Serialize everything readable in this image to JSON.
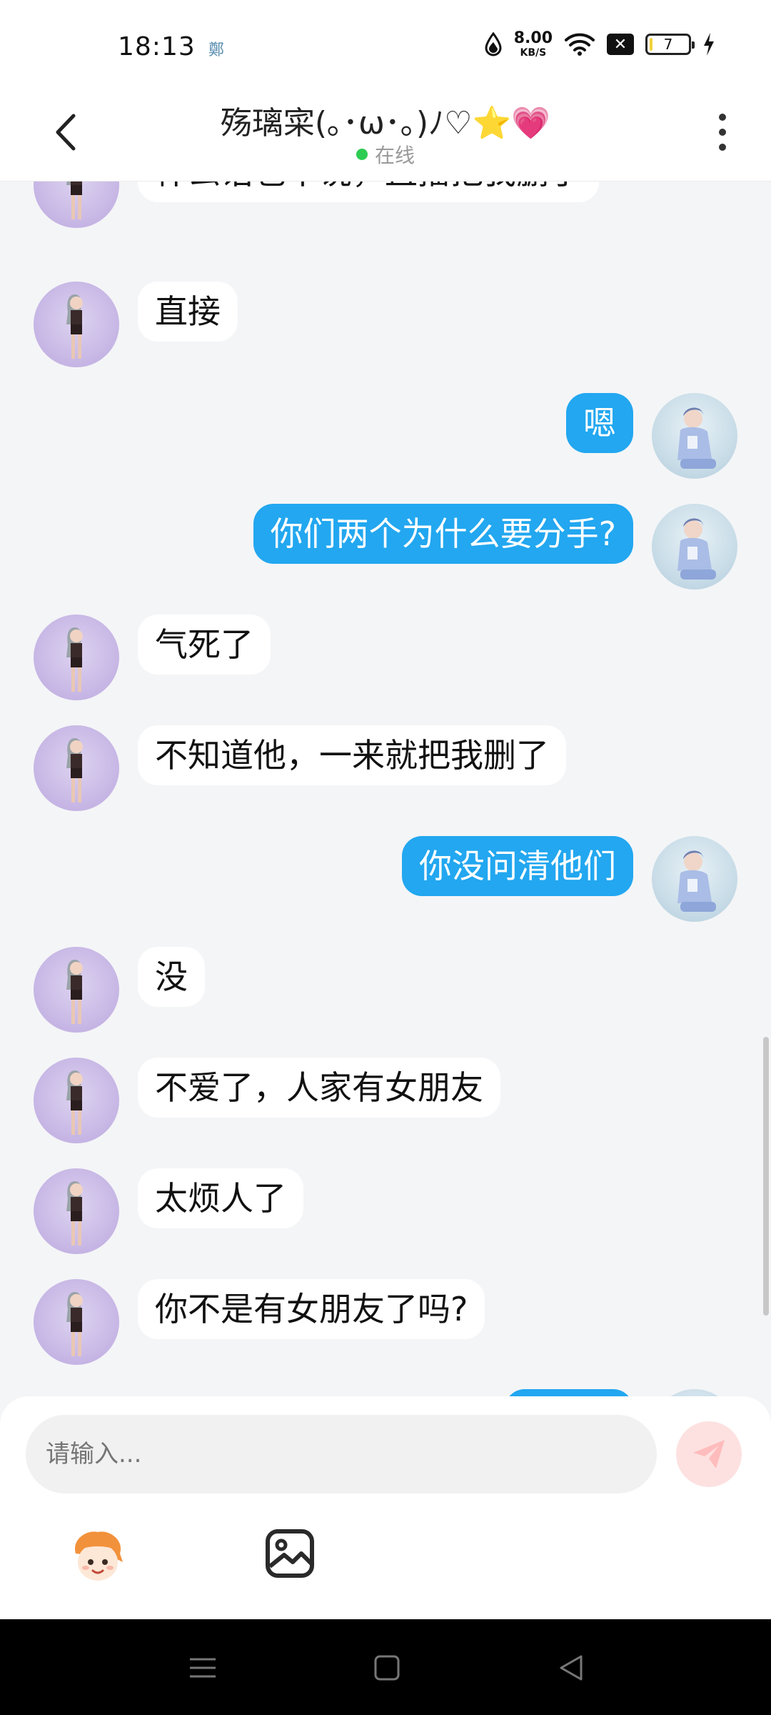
{
  "status_bar": {
    "time": "18:13",
    "app_icon": "鄭",
    "net_speed_value": "8.00",
    "net_speed_unit": "KB/S",
    "battery_level": "7"
  },
  "header": {
    "title": "殇璃寀(｡･ω･｡)ﾉ♡⭐💗",
    "status": "在线"
  },
  "messages": [
    {
      "side": "left",
      "text": "什么话也不说，直播把我删了"
    },
    {
      "side": "left",
      "text": "直接"
    },
    {
      "side": "right",
      "text": "嗯"
    },
    {
      "side": "right",
      "text": "你们两个为什么要分手?"
    },
    {
      "side": "left",
      "text": "气死了"
    },
    {
      "side": "left",
      "text": "不知道他，一来就把我删了"
    },
    {
      "side": "right",
      "text": "你没问清他们"
    },
    {
      "side": "left",
      "text": "没"
    },
    {
      "side": "left",
      "text": "不爱了，人家有女朋友"
    },
    {
      "side": "left",
      "text": "太烦人了"
    },
    {
      "side": "left",
      "text": "你不是有女朋友了吗?"
    }
  ],
  "input": {
    "placeholder": "请输入..."
  },
  "colors": {
    "accent_blue": "#22a7f0",
    "online_green": "#2ecc52",
    "send_button_bg": "#fde1e1",
    "send_button_icon": "#ffbcbc"
  },
  "icons": {
    "back": "chevron-left-icon",
    "more": "more-vertical-icon",
    "send": "send-icon",
    "emoji": "sticker-icon",
    "image": "image-icon"
  }
}
